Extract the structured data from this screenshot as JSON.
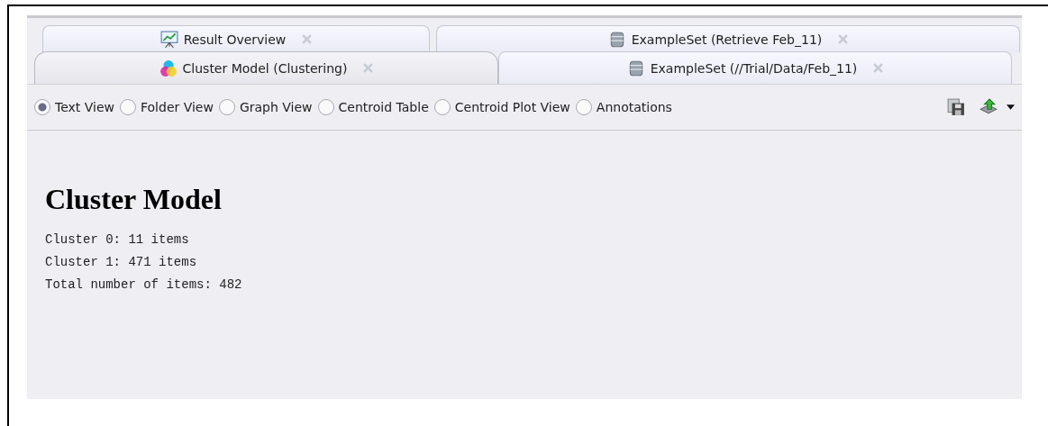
{
  "tab_rows": [
    {
      "tabs": [
        {
          "label": "Result Overview",
          "kind": "chart",
          "selected": false
        },
        {
          "label": "ExampleSet (Retrieve Feb_11)",
          "kind": "database",
          "selected": false
        }
      ]
    },
    {
      "tabs": [
        {
          "label": "Cluster Model (Clustering)",
          "kind": "palette",
          "selected": true
        },
        {
          "label": "ExampleSet (//Trial/Data/Feb_11)",
          "kind": "database",
          "selected": false
        }
      ]
    }
  ],
  "views": [
    {
      "label": "Text View",
      "selected": true
    },
    {
      "label": "Folder View",
      "selected": false
    },
    {
      "label": "Graph View",
      "selected": false
    },
    {
      "label": "Centroid Table",
      "selected": false
    },
    {
      "label": "Centroid Plot View",
      "selected": false
    },
    {
      "label": "Annotations",
      "selected": false
    }
  ],
  "content": {
    "title": "Cluster Model",
    "lines": [
      "Cluster 0: 11 items",
      "Cluster 1: 471 items",
      "Total number of items: 482"
    ]
  }
}
